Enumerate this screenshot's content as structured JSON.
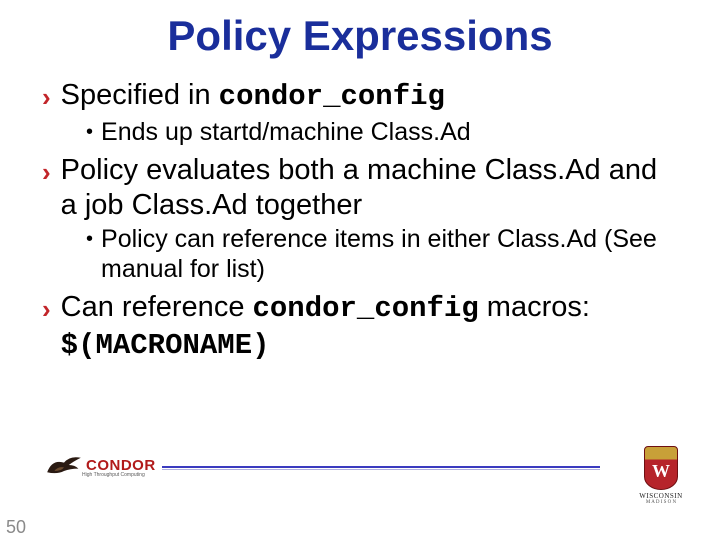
{
  "title": "Policy Expressions",
  "bullets": [
    {
      "level": 1,
      "pre": "Specified in ",
      "mono": "condor_config",
      "post": ""
    },
    {
      "level": 2,
      "pre": "Ends up startd/machine Class.Ad",
      "mono": "",
      "post": ""
    },
    {
      "level": 1,
      "pre": "Policy evaluates both a machine Class.Ad and a job Class.Ad together",
      "mono": "",
      "post": ""
    },
    {
      "level": 2,
      "pre": "Policy can reference items in either Class.Ad (See manual for list)",
      "mono": "",
      "post": ""
    },
    {
      "level": 1,
      "pre": "Can reference ",
      "mono": "condor_config",
      "post": " macros: ",
      "mono2": "$(MACRONAME)"
    }
  ],
  "footer": {
    "condor_label": "CONDOR",
    "condor_sub": "High Throughput Computing",
    "wisconsin_top": "WISCONSIN",
    "wisconsin_sub": "M A D I S O N"
  },
  "page_number": "50"
}
